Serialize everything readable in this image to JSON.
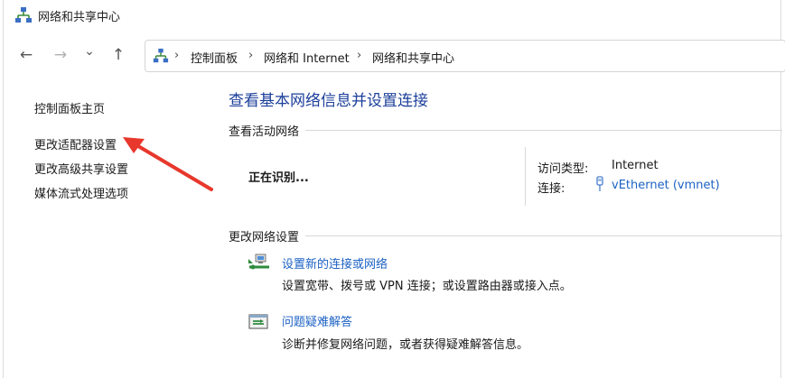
{
  "window": {
    "title": "网络和共享中心"
  },
  "nav": {
    "back_glyph": "←",
    "forward_glyph": "→",
    "recent_glyph": "⌄",
    "up_glyph": "↑"
  },
  "breadcrumb": {
    "separator": "›",
    "items": [
      "控制面板",
      "网络和 Internet",
      "网络和共享中心"
    ]
  },
  "sidebar": {
    "items": [
      "控制面板主页",
      "更改适配器设置",
      "更改高级共享设置",
      "媒体流式处理选项"
    ]
  },
  "main": {
    "title": "查看基本网络信息并设置连接",
    "active_networks_label": "查看活动网络",
    "network_status": "正在识别...",
    "access_type_label": "访问类型:",
    "access_type_value": "Internet",
    "connection_label": "连接:",
    "connection_value": "vEthernet (vmnet)",
    "change_settings_label": "更改网络设置",
    "tasks": [
      {
        "link": "设置新的连接或网络",
        "desc": "设置宽带、拨号或 VPN 连接；或设置路由器或接入点。"
      },
      {
        "link": "问题疑难解答",
        "desc": "诊断并修复网络问题，或者获得疑难解答信息。"
      }
    ]
  },
  "colors": {
    "title_blue": "#1c3f9b",
    "link_blue": "#1c62c4",
    "annotation_red": "#e8372c"
  },
  "icons": {
    "title": "network-share-center-icon",
    "address": "network-share-center-icon",
    "connection": "ethernet-plug-icon",
    "task_new_connection": "new-connection-icon",
    "task_troubleshoot": "troubleshoot-icon",
    "annotation": "red-arrow-icon"
  }
}
